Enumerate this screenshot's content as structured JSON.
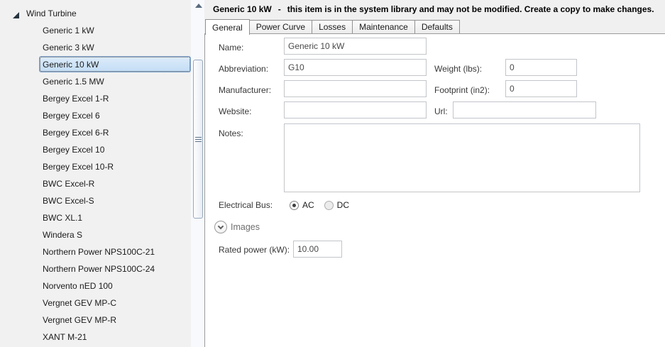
{
  "sidebar": {
    "root": {
      "label": "Wind Turbine",
      "expanded": true
    },
    "items": [
      {
        "label": "Generic 1 kW",
        "selected": false
      },
      {
        "label": "Generic 3 kW",
        "selected": false
      },
      {
        "label": "Generic 10 kW",
        "selected": true
      },
      {
        "label": "Generic 1.5 MW",
        "selected": false
      },
      {
        "label": "Bergey Excel 1-R",
        "selected": false
      },
      {
        "label": "Bergey Excel 6",
        "selected": false
      },
      {
        "label": "Bergey Excel 6-R",
        "selected": false
      },
      {
        "label": "Bergey Excel 10",
        "selected": false
      },
      {
        "label": "Bergey Excel 10-R",
        "selected": false
      },
      {
        "label": "BWC Excel-R",
        "selected": false
      },
      {
        "label": "BWC Excel-S",
        "selected": false
      },
      {
        "label": "BWC XL.1",
        "selected": false
      },
      {
        "label": "Windera S",
        "selected": false
      },
      {
        "label": "Northern Power NPS100C-21",
        "selected": false
      },
      {
        "label": "Northern Power NPS100C-24",
        "selected": false
      },
      {
        "label": "Norvento nED 100",
        "selected": false
      },
      {
        "label": "Vergnet GEV MP-C",
        "selected": false
      },
      {
        "label": "Vergnet GEV MP-R",
        "selected": false
      },
      {
        "label": "XANT M-21",
        "selected": false
      }
    ]
  },
  "header": {
    "title": "Generic 10 kW",
    "dash": "-",
    "message": "this item is in the system library and may not be modified. Create a copy to make changes."
  },
  "tabs": [
    {
      "label": "General",
      "active": true
    },
    {
      "label": "Power Curve",
      "active": false
    },
    {
      "label": "Losses",
      "active": false
    },
    {
      "label": "Maintenance",
      "active": false
    },
    {
      "label": "Defaults",
      "active": false
    }
  ],
  "form": {
    "name": {
      "label": "Name:",
      "value": "Generic 10 kW"
    },
    "abbreviation": {
      "label": "Abbreviation:",
      "value": "G10"
    },
    "manufacturer": {
      "label": "Manufacturer:",
      "value": ""
    },
    "website": {
      "label": "Website:",
      "value": ""
    },
    "notes": {
      "label": "Notes:",
      "value": ""
    },
    "weight": {
      "label": "Weight (lbs):",
      "value": "0"
    },
    "footprint": {
      "label": "Footprint (in2):",
      "value": "0"
    },
    "url": {
      "label": "Url:",
      "value": ""
    },
    "electrical_bus": {
      "label": "Electrical Bus:",
      "options": [
        {
          "label": "AC",
          "selected": true
        },
        {
          "label": "DC",
          "selected": false
        }
      ]
    },
    "images": {
      "label": "Images"
    },
    "rated_power": {
      "label": "Rated power (kW):",
      "value": "10.00"
    }
  },
  "icons": {
    "tree_expander": "triangle-expanded",
    "images_expander": "chevron-down",
    "scroll_up": "triangle-up",
    "thumb_grip": "grip-lines"
  },
  "colors": {
    "selection_fill": "#cfe3f7",
    "selection_border": "#7da2ce",
    "panel_background": "#f0f0f0"
  }
}
